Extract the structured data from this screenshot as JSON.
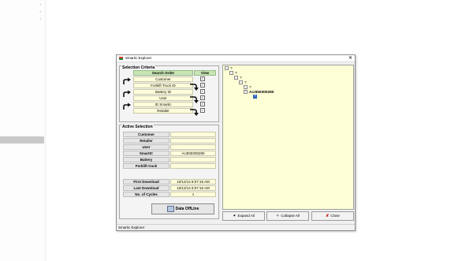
{
  "window": {
    "title": "Smartic Explorer",
    "close_glyph": "✕",
    "status_text": "Smartic Explorer"
  },
  "selection_criteria": {
    "title": "Selection Criteria",
    "col_search_order": "Search Order",
    "col_view": "View",
    "items": [
      {
        "label": "Customer",
        "checked": "✓"
      },
      {
        "label": "Forklift Truck ID",
        "checked": "✓"
      },
      {
        "label": "Battery ID",
        "checked": "✓"
      },
      {
        "label": "User",
        "checked": "✓"
      },
      {
        "label": "ID Smartic",
        "checked": "✓"
      },
      {
        "label": "Retailer",
        "checked": "✓"
      }
    ]
  },
  "active_selection": {
    "title": "Active Selection",
    "fields": [
      {
        "label": "Customer",
        "value": ""
      },
      {
        "label": "Retailer",
        "value": ""
      },
      {
        "label": "User",
        "value": ""
      },
      {
        "label": "SmartIC",
        "value": "Ac3DE000290"
      },
      {
        "label": "Battery",
        "value": ""
      },
      {
        "label": "Forklift truck",
        "value": ""
      }
    ],
    "stats": [
      {
        "label": "First Download",
        "value": "10/12/14 8:07:16 AM"
      },
      {
        "label": "Last Download",
        "value": "10/12/14 8:07:16 AM"
      },
      {
        "label": "No. of Cycles",
        "value": "1"
      }
    ],
    "data_button": "Data OffLine"
  },
  "tree": {
    "nodes": [
      {
        "text": "?"
      },
      {
        "text": "?"
      },
      {
        "text": "?"
      },
      {
        "text": "?"
      },
      {
        "text": "?"
      },
      {
        "text": "Ac3DE000290"
      },
      {
        "text": "?"
      }
    ]
  },
  "buttons": {
    "expand_all": "Expand All",
    "collapse_all": "Collapse All",
    "close": "Close"
  },
  "colors": {
    "view_header": "#c8e6b4",
    "field_fill": "#fffddc",
    "tree_bg": "#fefed6",
    "selection": "#2b5fbf",
    "close_icon": "#c0271f"
  },
  "icons": [
    "app-icon",
    "arrow-up-icon",
    "arrow-down-icon",
    "expand-all-icon",
    "collapse-all-icon",
    "close-icon",
    "data-offline-icon"
  ]
}
